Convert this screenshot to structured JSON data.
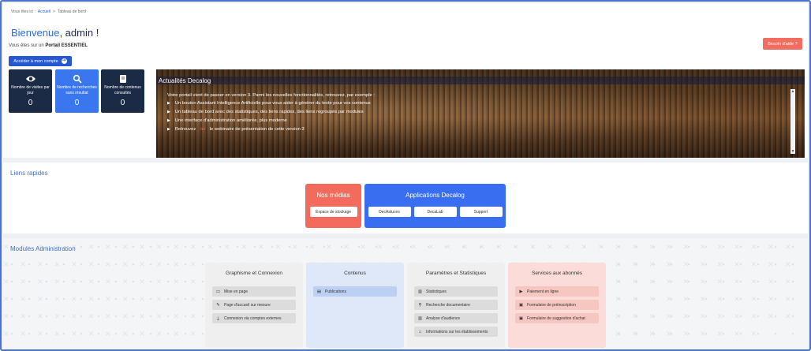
{
  "breadcrumb": {
    "part1": "Vous êtes ici :",
    "part2": "Accueil",
    "sep": ">",
    "part3": "Tableau de bord"
  },
  "welcome": {
    "highlight": "Bienvenue",
    "rest": ", admin !"
  },
  "portal": {
    "prefix": "Vous êtes sur un",
    "name": "Portail ESSENTIEL"
  },
  "help_button": "Besoin d'aide ?",
  "account_button": "Accéder à mon compte",
  "stats": [
    {
      "icon": "eye-icon",
      "label": "Nombre de visites par jour",
      "value": "0"
    },
    {
      "icon": "search-icon",
      "label": "Nombre de recherches sans résultat",
      "value": "0"
    },
    {
      "icon": "book-icon",
      "label": "Nombre de contenus consultés",
      "value": "0"
    }
  ],
  "news": {
    "title": "Actualités Decalog",
    "intro": "Votre portail vient de passer en version 3. Parmi les nouvelles fonctionnalités, retrouvez, par exemple :",
    "items": [
      "Un bouton Assistant Intelligence Artificielle pour vous aider à générer du texte pour vos contenus",
      "Un tableau de bord avec des statistiques, des liens rapides, des liens regroupés par modules",
      "Une interface d'administration améliorée, plus moderne"
    ],
    "last_prefix": "Retrouvez",
    "last_link": "ici",
    "last_suffix": "le webinaire de présentation de cette version 3"
  },
  "liens": {
    "title": "Liens rapides",
    "medias": {
      "title": "Nos médias",
      "buttons": [
        "Espace de stockage"
      ]
    },
    "apps": {
      "title": "Applications Decalog",
      "buttons": [
        "DecAstuces",
        "DecaLab",
        "Support"
      ]
    }
  },
  "modules": {
    "title": "Modules Administration",
    "cards": [
      {
        "title": "Graphisme et Connexion",
        "items": [
          {
            "icon": "monitor-icon",
            "label": "Mise en page"
          },
          {
            "icon": "brush-icon",
            "label": "Page d'accueil sur mesure"
          },
          {
            "icon": "plug-icon",
            "label": "Connexion via comptes externes"
          }
        ]
      },
      {
        "title": "Contenus",
        "items": [
          {
            "icon": "document-icon",
            "label": "Publications"
          }
        ]
      },
      {
        "title": "Paramètres et Statistiques",
        "items": [
          {
            "icon": "chart-icon",
            "label": "Statistiques"
          },
          {
            "icon": "search-icon",
            "label": "Recherche documentaire"
          },
          {
            "icon": "chart-icon",
            "label": "Analyse d'audience"
          },
          {
            "icon": "home-icon",
            "label": "Informations sur les établissements"
          }
        ]
      },
      {
        "title": "Services aux abonnés",
        "items": [
          {
            "icon": "video-icon",
            "label": "Paiement en ligne"
          },
          {
            "icon": "form-icon",
            "label": "Formulaire de préinscription"
          },
          {
            "icon": "form-icon",
            "label": "Formulaire de suggestion d'achat"
          }
        ]
      }
    ]
  },
  "colors": {
    "primary": "#2558d2",
    "accent": "#f26c5f",
    "dark": "#1b2a45",
    "blue": "#3a76ee"
  }
}
